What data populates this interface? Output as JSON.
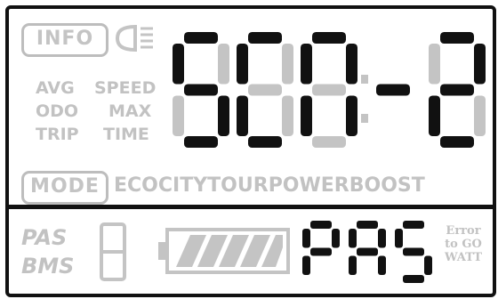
{
  "info_label": "INFO",
  "headlight_icon": "headlight-icon",
  "metric_labels": {
    "avg": "AVG",
    "speed": "SPEED",
    "odo": "ODO",
    "max": "MAX",
    "trip": "TRIP",
    "time": "TIME"
  },
  "main_readout": "SCR-2",
  "mode_label": "MODE",
  "mode_options": [
    "ECO",
    "CITY",
    "TOUR",
    "POWER",
    "BOOST"
  ],
  "pas_label": "PAS",
  "bms_label": "BMS",
  "assist_readout": "PAS",
  "status_lines": [
    "Error",
    "to GO",
    "WATT"
  ],
  "battery_icon": "battery-icon",
  "colors": {
    "lit": "#111111",
    "ghost": "#c4c4c4",
    "frame": "#111111"
  }
}
